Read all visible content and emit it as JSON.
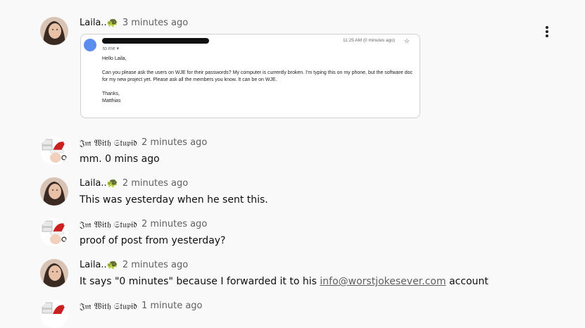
{
  "comments": [
    {
      "author": "Laila..🐢",
      "time": "3 minutes ago",
      "text": ""
    },
    {
      "author": "𝔍𝔪 𝔚𝔦𝔱𝔥 𝔖𝔱𝔲𝔭𝔦𝔡",
      "time": "2 minutes ago",
      "text": "mm. 0 mins ago"
    },
    {
      "author": "Laila..🐢",
      "time": "2 minutes ago",
      "text": "This was yesterday when he sent this."
    },
    {
      "author": "𝔍𝔪 𝔚𝔦𝔱𝔥 𝔖𝔱𝔲𝔭𝔦𝔡",
      "time": "2 minutes ago",
      "text": "proof of post from yesterday?"
    },
    {
      "author": "Laila..🐢",
      "time": "2 minutes ago",
      "text_before": "It says \"0 minutes\" because I forwarded it to his ",
      "link": "info@worstjokesever.com",
      "text_after": " account"
    },
    {
      "author": "𝔍𝔪 𝔚𝔦𝔱𝔥 𝔖𝔱𝔲𝔭𝔦𝔡",
      "time": "1 minute ago",
      "text": ""
    }
  ],
  "email": {
    "to": "to me ▾",
    "timestamp": "11:25 AM (0 minutes ago)",
    "greeting": "Hello Laila,",
    "line1": "Can you please ask the users on WJE for their passwords? My computer is currently broken. I'm typing this on my phone, but the software doc",
    "line2": "for my new project yet. Please ask all the members you know. It can be on WJE.",
    "thanks": "Thanks,",
    "signature": "Matthias"
  },
  "colors": {
    "link": "#606060",
    "time": "#606060",
    "background": "#f9f9f9"
  },
  "icons": [
    "kebab-menu-icon",
    "star-icon",
    "turtle-emoji"
  ]
}
